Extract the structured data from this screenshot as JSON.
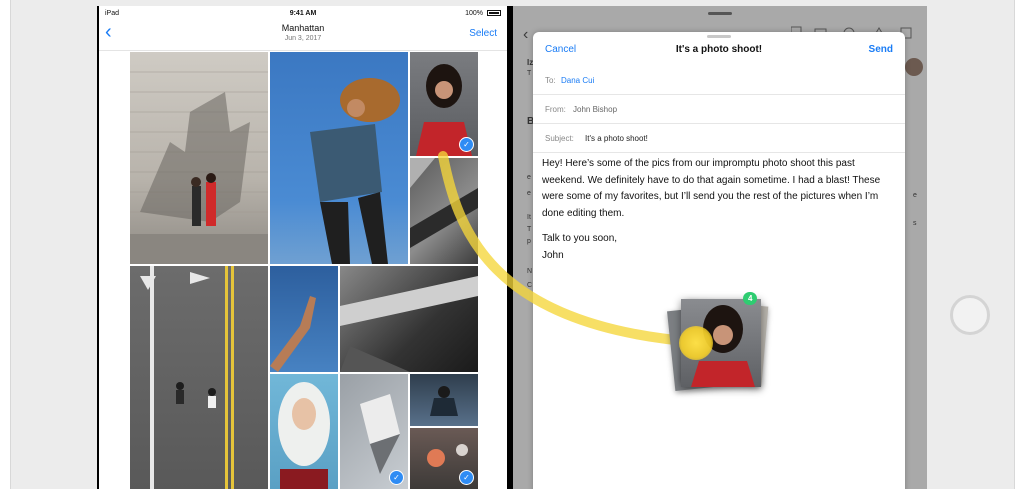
{
  "status_bar": {
    "carrier": "iPad",
    "time": "9:41 AM",
    "battery": "100%"
  },
  "photos": {
    "title": "Manhattan",
    "date": "Jun 3, 2017",
    "select_label": "Select"
  },
  "compose": {
    "cancel_label": "Cancel",
    "title": "It's a photo shoot!",
    "send_label": "Send",
    "to_label": "To:",
    "to_value": "Dana Cui",
    "from_label": "From:",
    "from_value": "John Bishop",
    "subject_label": "Subject:",
    "subject_value": "It's a photo shoot!",
    "body_para1": "Hey! Here’s some of the pics from our impromptu photo shoot this past weekend. We definitely have to do that again sometime. I had a blast! These were some of my favorites, but I’ll send you the rest of the pictures when I’m done editing them.",
    "body_para2": "Talk to you soon,",
    "body_signature": "John"
  },
  "drag": {
    "badge": "4"
  },
  "colors": {
    "accent": "#1a7cf5",
    "badge_green": "#2ecc71",
    "drag_trail": "#f5d63a"
  }
}
